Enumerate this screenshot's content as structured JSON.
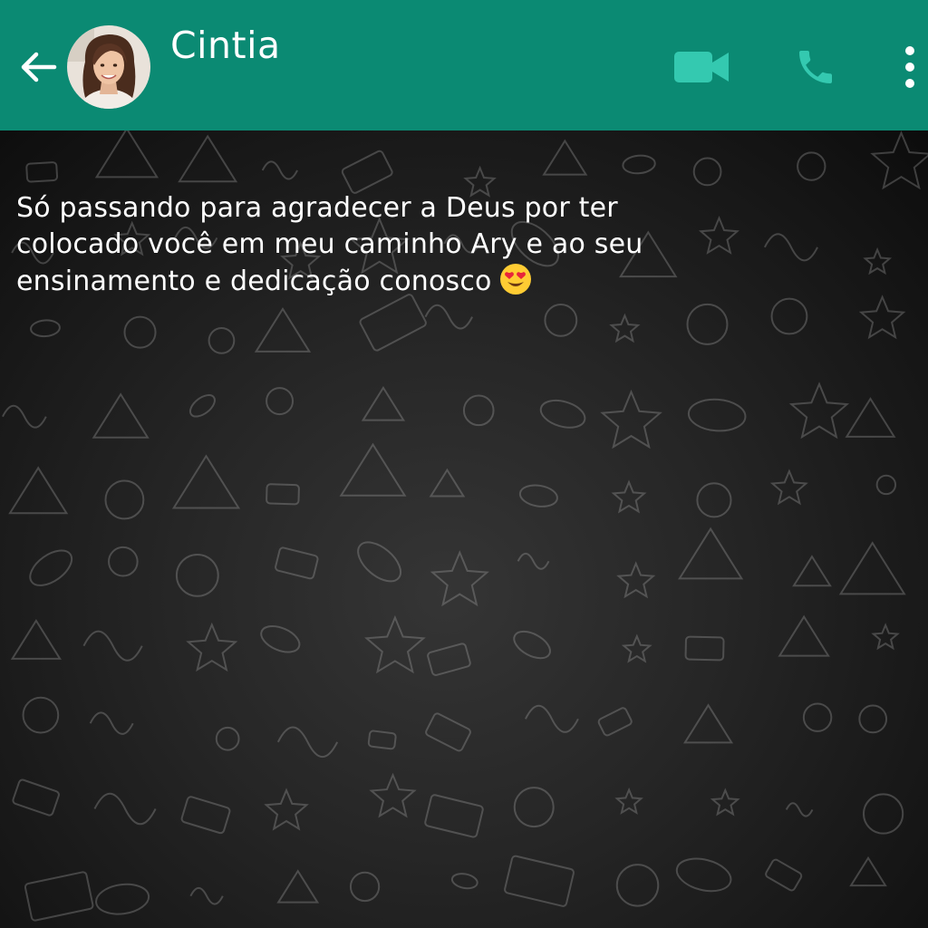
{
  "header": {
    "contact_name": "Cintia",
    "background_color": "#0b8a73",
    "icons": {
      "back": "arrow-left-icon",
      "video": "video-camera-icon",
      "call": "phone-icon",
      "menu": "more-vertical-icon"
    }
  },
  "chat": {
    "wallpaper": "doodle-pattern",
    "messages": [
      {
        "text": "Só passando para agradecer a Deus por ter colocado você em meu caminho Ary e ao seu ensinamento e dedicação conosco",
        "emoji": "heart-eyes-emoji"
      }
    ]
  }
}
